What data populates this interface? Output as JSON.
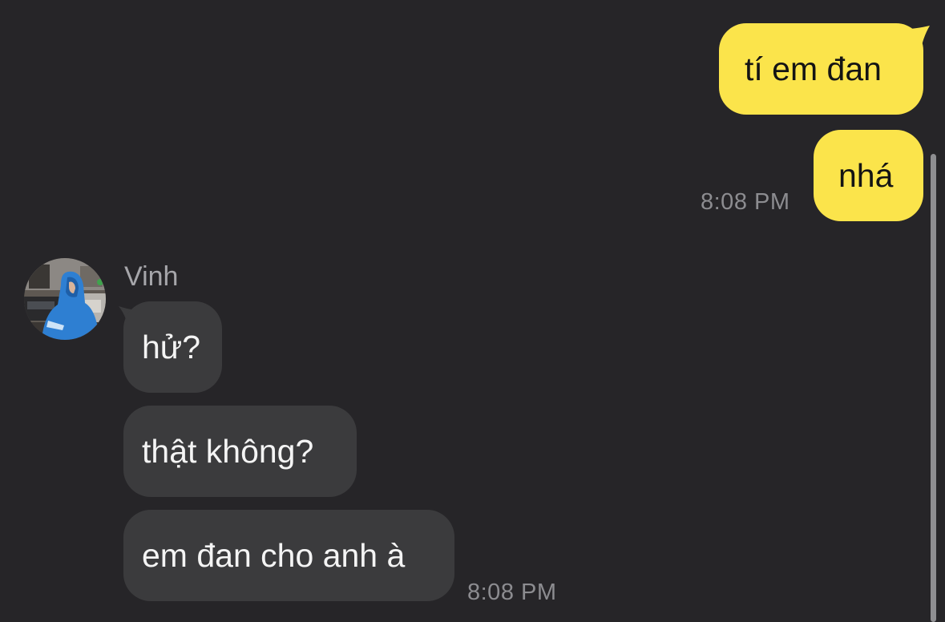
{
  "conversation": {
    "outgoing": [
      {
        "text": "tí em đan"
      },
      {
        "text": "nhá"
      }
    ],
    "outgoing_time": "8:08 PM",
    "sender_name": "Vinh",
    "incoming": [
      {
        "text": "hử?"
      },
      {
        "text": "thật không?"
      },
      {
        "text": "em đan cho anh à"
      }
    ],
    "incoming_time": "8:08 PM"
  },
  "colors": {
    "background": "#262528",
    "outgoing_bubble": "#FBE44B",
    "incoming_bubble": "#3B3B3D",
    "timestamp": "#8C8C90"
  },
  "icons": {
    "avatar": "profile-photo-person-in-blue-hoodie"
  }
}
